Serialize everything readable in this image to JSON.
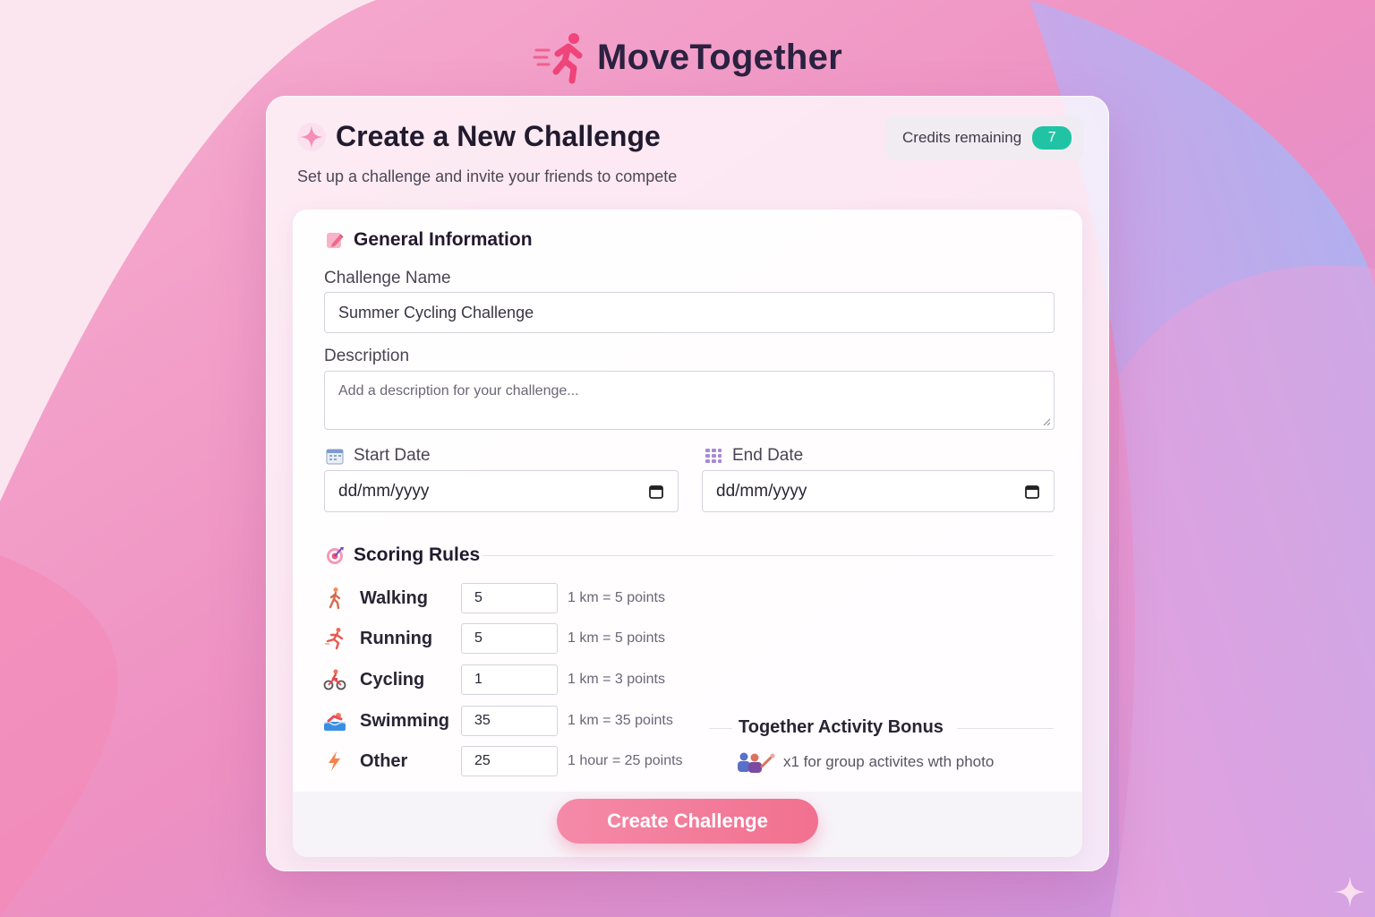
{
  "app": {
    "title": "MoveTogether"
  },
  "card": {
    "title": "Create a New Challenge",
    "subtitle": "Set up a challenge and invite your friends to compete",
    "credits_label": "Credits remaining",
    "credits_value": "7"
  },
  "general": {
    "section_title": "General Information",
    "name_label": "Challenge Name",
    "name_value": "Summer Cycling Challenge",
    "description_label": "Description",
    "description_placeholder": "Add a description for your challenge...",
    "start_label": "Start Date",
    "start_value": "dd/mm/yyyy",
    "end_label": "End Date",
    "end_value": "dd/mm/yyyy"
  },
  "scoring": {
    "section_title": "Scoring Rules",
    "rules": [
      {
        "name": "Walking",
        "value": "5",
        "desc": "1 km = 5 points",
        "icon": "walking-icon"
      },
      {
        "name": "Running",
        "value": "5",
        "desc": "1 km = 5 points",
        "icon": "running-icon"
      },
      {
        "name": "Cycling",
        "value": "1",
        "desc": "1 km = 3 points",
        "icon": "cycling-icon"
      },
      {
        "name": "Swimming",
        "value": "35",
        "desc": "1 km = 35 points",
        "icon": "swimming-icon"
      },
      {
        "name": "Other",
        "value": "25",
        "desc": "1 hour = 25 points",
        "icon": "lightning-icon"
      }
    ]
  },
  "bonus": {
    "title": "Together Activity Bonus",
    "text": "x1 for group activites wth  photo",
    "icon": "group-people-icon"
  },
  "actions": {
    "create_label": "Create Challenge"
  },
  "colors": {
    "accent": "#f2708f",
    "credits_badge": "#20c4a4",
    "brand_icon": "#f0457a"
  }
}
